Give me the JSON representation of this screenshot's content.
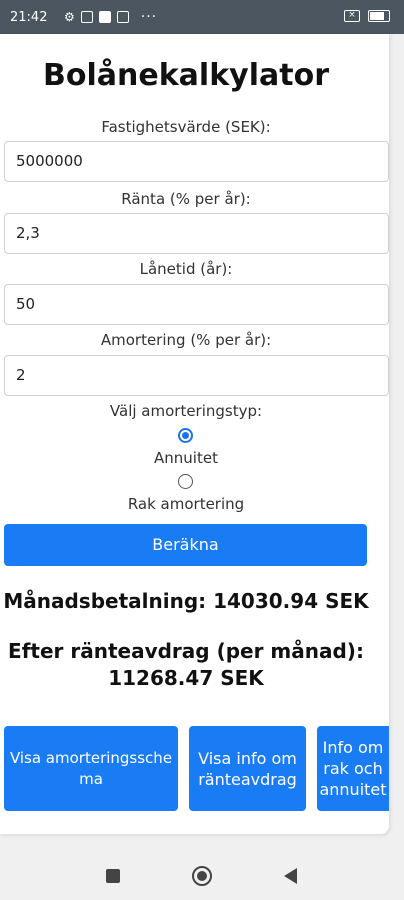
{
  "status_bar": {
    "time": "21:42",
    "more": "···"
  },
  "app": {
    "title": "Bolånekalkylator"
  },
  "form": {
    "property_value_label": "Fastighetsvärde (SEK):",
    "property_value": "5000000",
    "interest_label": "Ränta (% per år):",
    "interest": "2,3",
    "loan_term_label": "Lånetid (år):",
    "loan_term": "50",
    "amortization_label": "Amortering (% per år):",
    "amortization": "2",
    "amortization_type_label": "Välj amorteringstyp:",
    "options": [
      {
        "label": "Annuitet",
        "checked": true
      },
      {
        "label": "Rak amortering",
        "checked": false
      }
    ],
    "calculate_label": "Beräkna"
  },
  "results": {
    "monthly_payment": "Månadsbetalning: 14030.94 SEK",
    "after_deduction_label": "Efter ränteavdrag (per månad):",
    "after_deduction_value": "11268.47 SEK"
  },
  "buttons": {
    "schedule": "Visa amorteringsschema",
    "deduction_info": "Visa info om ränteavdrag",
    "straight_vs_annuity": "Info om rak och annuitet"
  }
}
